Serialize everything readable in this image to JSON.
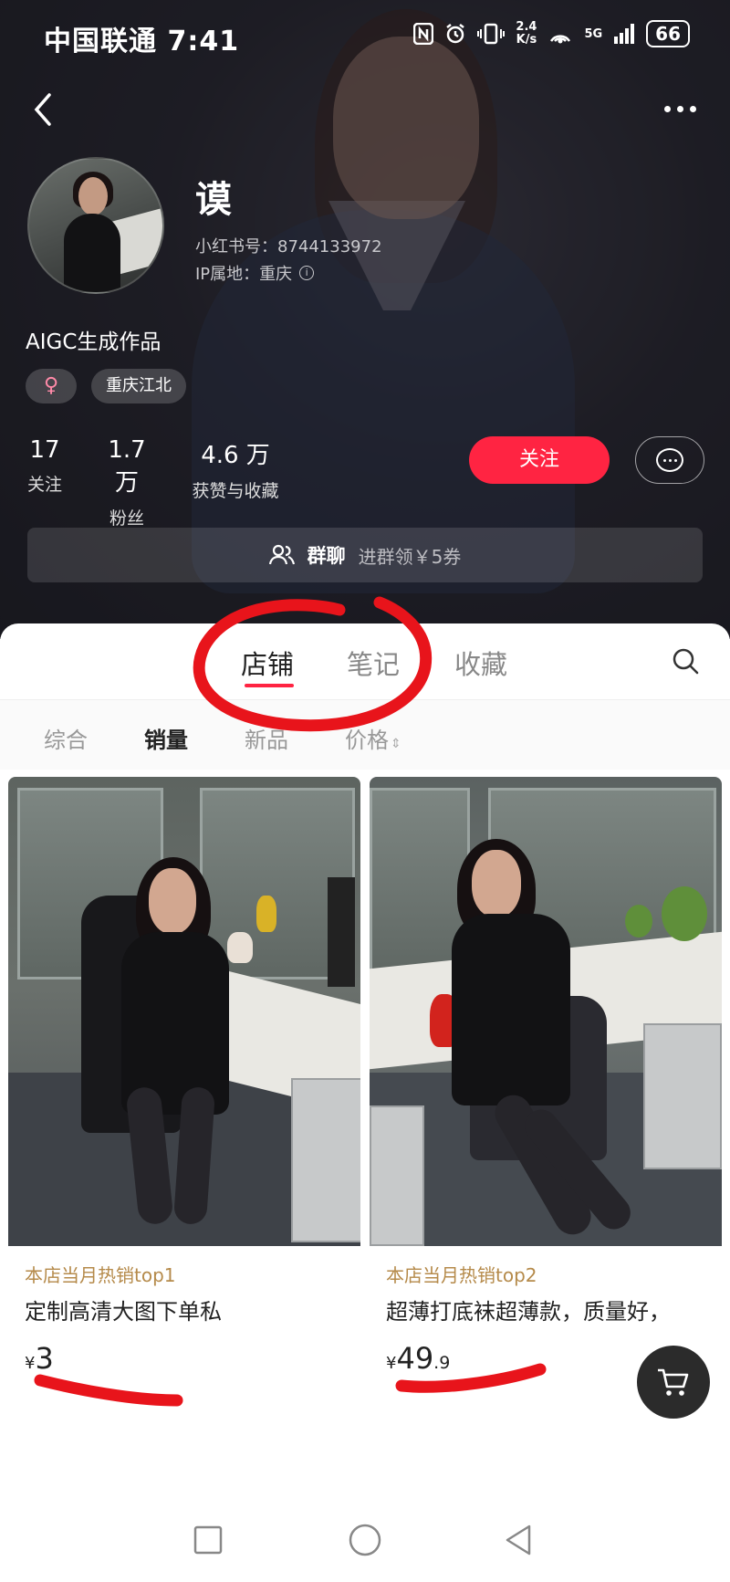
{
  "status_bar": {
    "carrier_time": "中国联通 7:41",
    "net_speed_value": "2.4",
    "net_speed_unit": "K/s",
    "signal": "5G",
    "battery": "66"
  },
  "profile": {
    "username": "谟",
    "redbook_id": "小红书号：8744133972",
    "ip_location": "IP属地：重庆",
    "bio": "AIGC生成作品",
    "gender_symbol": "♀",
    "location_tag": "重庆江北"
  },
  "stats": [
    {
      "value": "17",
      "label": "关注"
    },
    {
      "value": "1.7 万",
      "label": "粉丝"
    },
    {
      "value": "4.6 万",
      "label": "获赞与收藏"
    }
  ],
  "actions": {
    "follow_label": "关注"
  },
  "group_chat": {
    "label": "群聊",
    "promo": "进群领￥5券"
  },
  "tabs": [
    {
      "label": "店铺",
      "active": true
    },
    {
      "label": "笔记",
      "active": false
    },
    {
      "label": "收藏",
      "active": false
    }
  ],
  "sort_options": [
    {
      "label": "综合",
      "active": false
    },
    {
      "label": "销量",
      "active": true
    },
    {
      "label": "新品",
      "active": false
    },
    {
      "label": "价格",
      "active": false
    }
  ],
  "products": [
    {
      "tag": "本店当月热销top1",
      "title": "定制高清大图下单私",
      "price_symbol": "¥",
      "price_int": "3",
      "price_dec": ""
    },
    {
      "tag": "本店当月热销top2",
      "title": "超薄打底袜超薄款，质量好，",
      "price_symbol": "¥",
      "price_int": "49",
      "price_dec": ".9"
    }
  ],
  "colors": {
    "accent": "#ff2442",
    "annotation_red": "#e8141b",
    "tag_gold": "#b58a4a"
  },
  "icons": [
    "back-icon",
    "more-icon",
    "info-icon",
    "gender-female-icon",
    "message-icon",
    "group-icon",
    "search-icon",
    "cart-icon",
    "nav-recent-icon",
    "nav-home-icon",
    "nav-back-icon"
  ]
}
